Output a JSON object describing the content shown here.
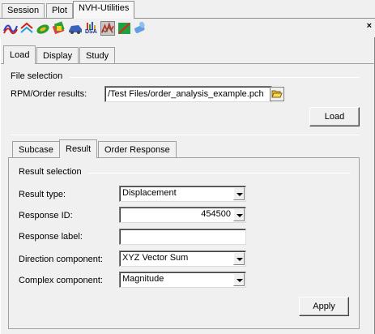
{
  "top_tabs": [
    "Session",
    "Plot",
    "NVH-Utilities"
  ],
  "toolbar": {
    "icons": [
      "curve-icon",
      "wave-icon",
      "model-icon",
      "diagnostics-icon",
      "car-icon",
      "dsa-icon",
      "order-icon",
      "plot-icon",
      "cylinder-icon"
    ],
    "dsa_text": "DSA",
    "close_label": "×"
  },
  "main_tabs": [
    "Load",
    "Display",
    "Study"
  ],
  "file_selection": {
    "heading": "File selection",
    "rpm_label": "RPM/Order results:",
    "rpm_value": "/Test Files/order_analysis_example.pch",
    "load_button": "Load"
  },
  "sub_tabs": [
    "Subcase",
    "Result",
    "Order Response"
  ],
  "result_selection": {
    "heading": "Result selection",
    "rows": [
      {
        "label": "Result type:",
        "value": "Displacement"
      },
      {
        "label": "Response ID:",
        "value": "454500"
      },
      {
        "label": "Response label:",
        "value": ""
      },
      {
        "label": "Direction component:",
        "value": "XYZ Vector Sum"
      },
      {
        "label": "Complex component:",
        "value": "Magnitude"
      }
    ],
    "apply_button": "Apply"
  }
}
